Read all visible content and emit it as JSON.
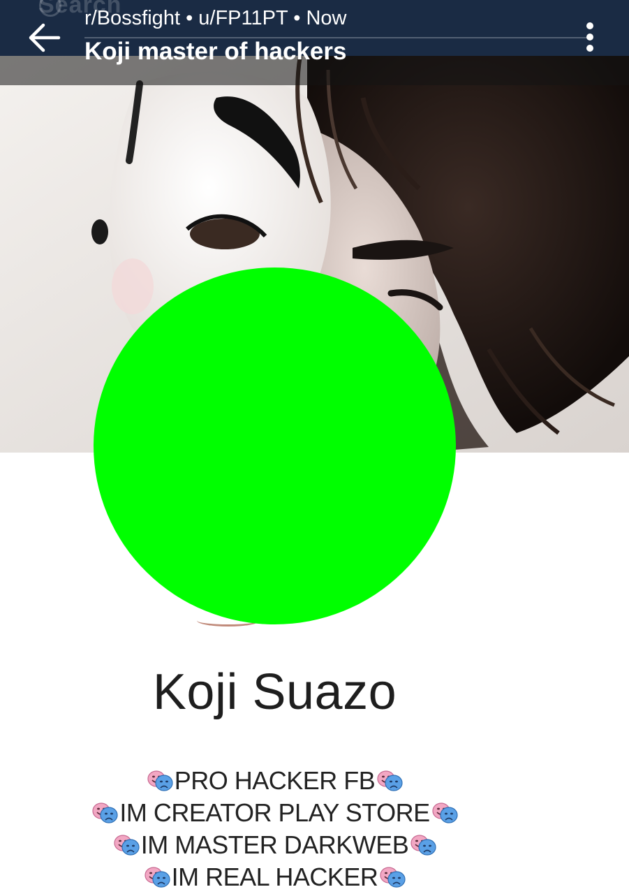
{
  "app_bar": {
    "search_hint": "Search",
    "subreddit": "r/Bossfight",
    "separator": "•",
    "author": "u/FP11PT",
    "time": "Now",
    "post_title": "Koji master of hackers"
  },
  "profile": {
    "name": "Koji Suazo",
    "bio_lines": [
      "PRO HACKER FB",
      "IM CREATOR PLAY STORE",
      "IM MASTER DARKWEB",
      "IM REAL HACKER"
    ],
    "bio_icon": "performing-arts-masks-icon"
  },
  "colors": {
    "app_bar": "#1a2b44",
    "censor_circle": "#00ff00",
    "name_text": "#1e1e1e"
  }
}
